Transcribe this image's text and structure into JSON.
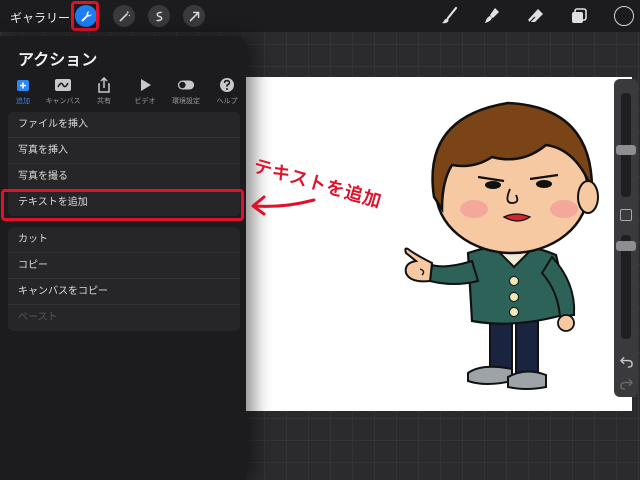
{
  "toolbar": {
    "gallery_label": "ギャラリー",
    "left_tools": [
      "wrench-icon",
      "magic-wand-icon",
      "selection-icon",
      "transform-arrow-icon"
    ],
    "right_tools": [
      "brush-icon",
      "smudge-icon",
      "eraser-icon",
      "layers-icon"
    ],
    "accent": "#1f7cf2"
  },
  "panel": {
    "title": "アクション",
    "tabs": [
      {
        "icon": "add-icon",
        "label": "追加",
        "active": true
      },
      {
        "icon": "canvas-icon",
        "label": "キャンバス"
      },
      {
        "icon": "share-icon",
        "label": "共有"
      },
      {
        "icon": "video-icon",
        "label": "ビデオ"
      },
      {
        "icon": "prefs-toggle-icon",
        "label": "環境設定"
      },
      {
        "icon": "help-icon",
        "label": "ヘルプ"
      }
    ],
    "group1": [
      "ファイルを挿入",
      "写真を挿入",
      "写真を撮る",
      "テキストを追加"
    ],
    "group2": [
      "カット",
      "コピー",
      "キャンバスをコピー",
      "ペースト"
    ]
  },
  "annotation": {
    "text": "テキストを追加",
    "color": "#e0112b"
  },
  "sidebar": {
    "icons": [
      "undo-icon",
      "redo-icon"
    ]
  }
}
